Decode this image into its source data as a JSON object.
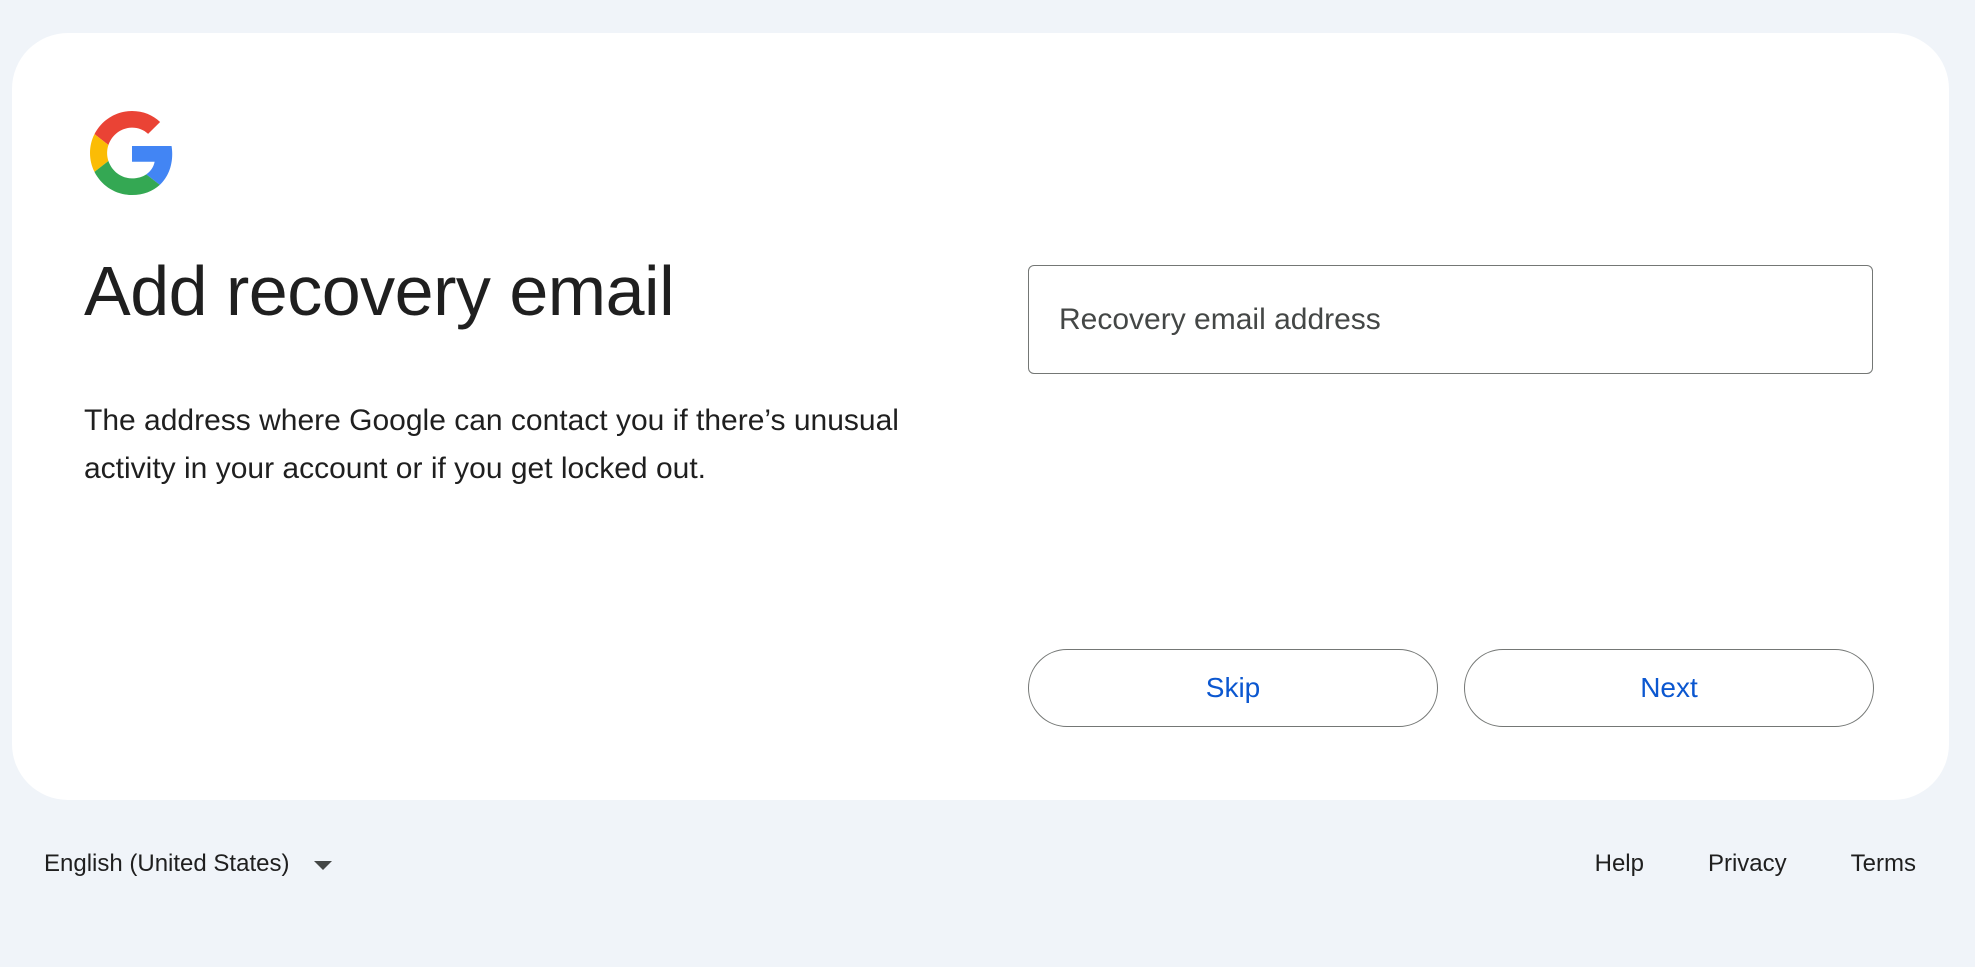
{
  "card": {
    "title": "Add recovery email",
    "description": "The address where Google can contact you if there’s unusual activity in your account or if you get locked out."
  },
  "recovery_email": {
    "placeholder": "Recovery email address",
    "value": ""
  },
  "buttons": {
    "skip_label": "Skip",
    "next_label": "Next"
  },
  "footer": {
    "language": "English (United States)",
    "links": [
      "Help",
      "Privacy",
      "Terms"
    ]
  },
  "icons": {
    "logo": "google-g-icon",
    "language_dropdown": "triangle-down-icon"
  },
  "colors": {
    "page_background": "#f0f4f9",
    "card_background": "#ffffff",
    "button_text": "#0b57d0",
    "logo_red": "#EA4335",
    "logo_yellow": "#FBBC05",
    "logo_green": "#34A853",
    "logo_blue": "#4285F4"
  }
}
